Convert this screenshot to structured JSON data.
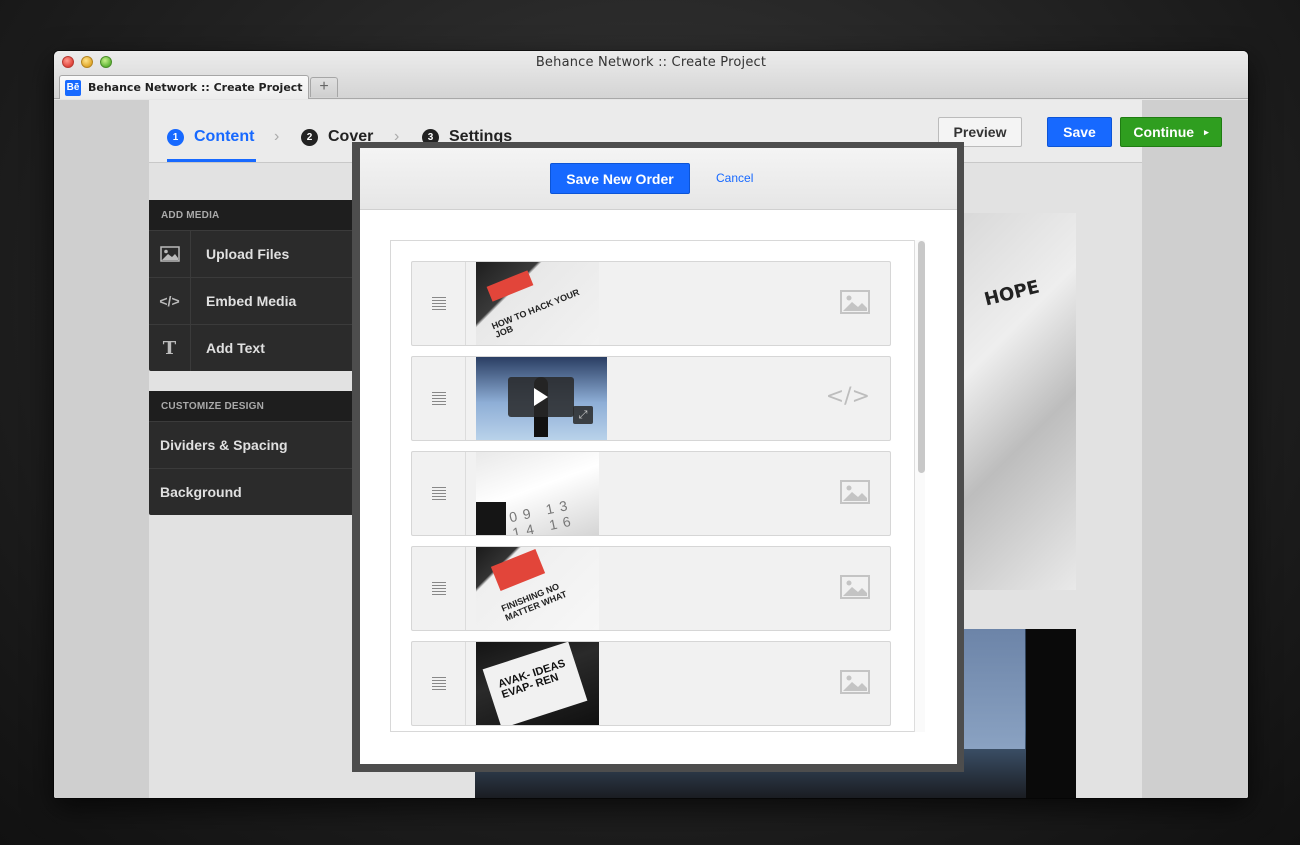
{
  "window": {
    "title": "Behance Network :: Create Project",
    "tab": {
      "favicon": "Bē",
      "label": "Behance Network :: Create Project"
    },
    "new_tab": "+"
  },
  "steps": [
    {
      "num": "1",
      "label": "Content"
    },
    {
      "num": "2",
      "label": "Cover"
    },
    {
      "num": "3",
      "label": "Settings"
    }
  ],
  "step_separator": "›",
  "toolbar": {
    "preview_label": "Preview",
    "save_label": "Save",
    "continue_label": "Continue",
    "continue_arrow": "▸"
  },
  "sidebar": {
    "add_media": {
      "heading": "ADD MEDIA",
      "items": [
        {
          "icon": "image-icon",
          "label": "Upload Files"
        },
        {
          "icon": "code-icon",
          "glyph": "</>",
          "label": "Embed Media"
        },
        {
          "icon": "text-icon",
          "glyph": "T",
          "label": "Add Text"
        }
      ]
    },
    "customize": {
      "heading": "CUSTOMIZE DESIGN",
      "items": [
        {
          "label": "Dividers & Spacing"
        },
        {
          "label": "Background"
        }
      ]
    }
  },
  "background": {
    "poster_text": "HOPE"
  },
  "modal": {
    "save_order_label": "Save New Order",
    "cancel_label": "Cancel",
    "rows": [
      {
        "type": "image",
        "thumb_text": "HOW TO HACK YOUR JOB"
      },
      {
        "type": "embed",
        "type_glyph": "</>",
        "expand_glyph": "⤢"
      },
      {
        "type": "image",
        "thumb_text": "09 13 14 16"
      },
      {
        "type": "image",
        "thumb_text": "FINISHING NO MATTER WHAT"
      },
      {
        "type": "image",
        "thumb_text": "AVAK- IDEAS EVAP- REN"
      }
    ]
  },
  "colors": {
    "accent": "#1769ff",
    "continue": "#2f9e1f",
    "sidebar_bg": "#2b2b2b"
  }
}
